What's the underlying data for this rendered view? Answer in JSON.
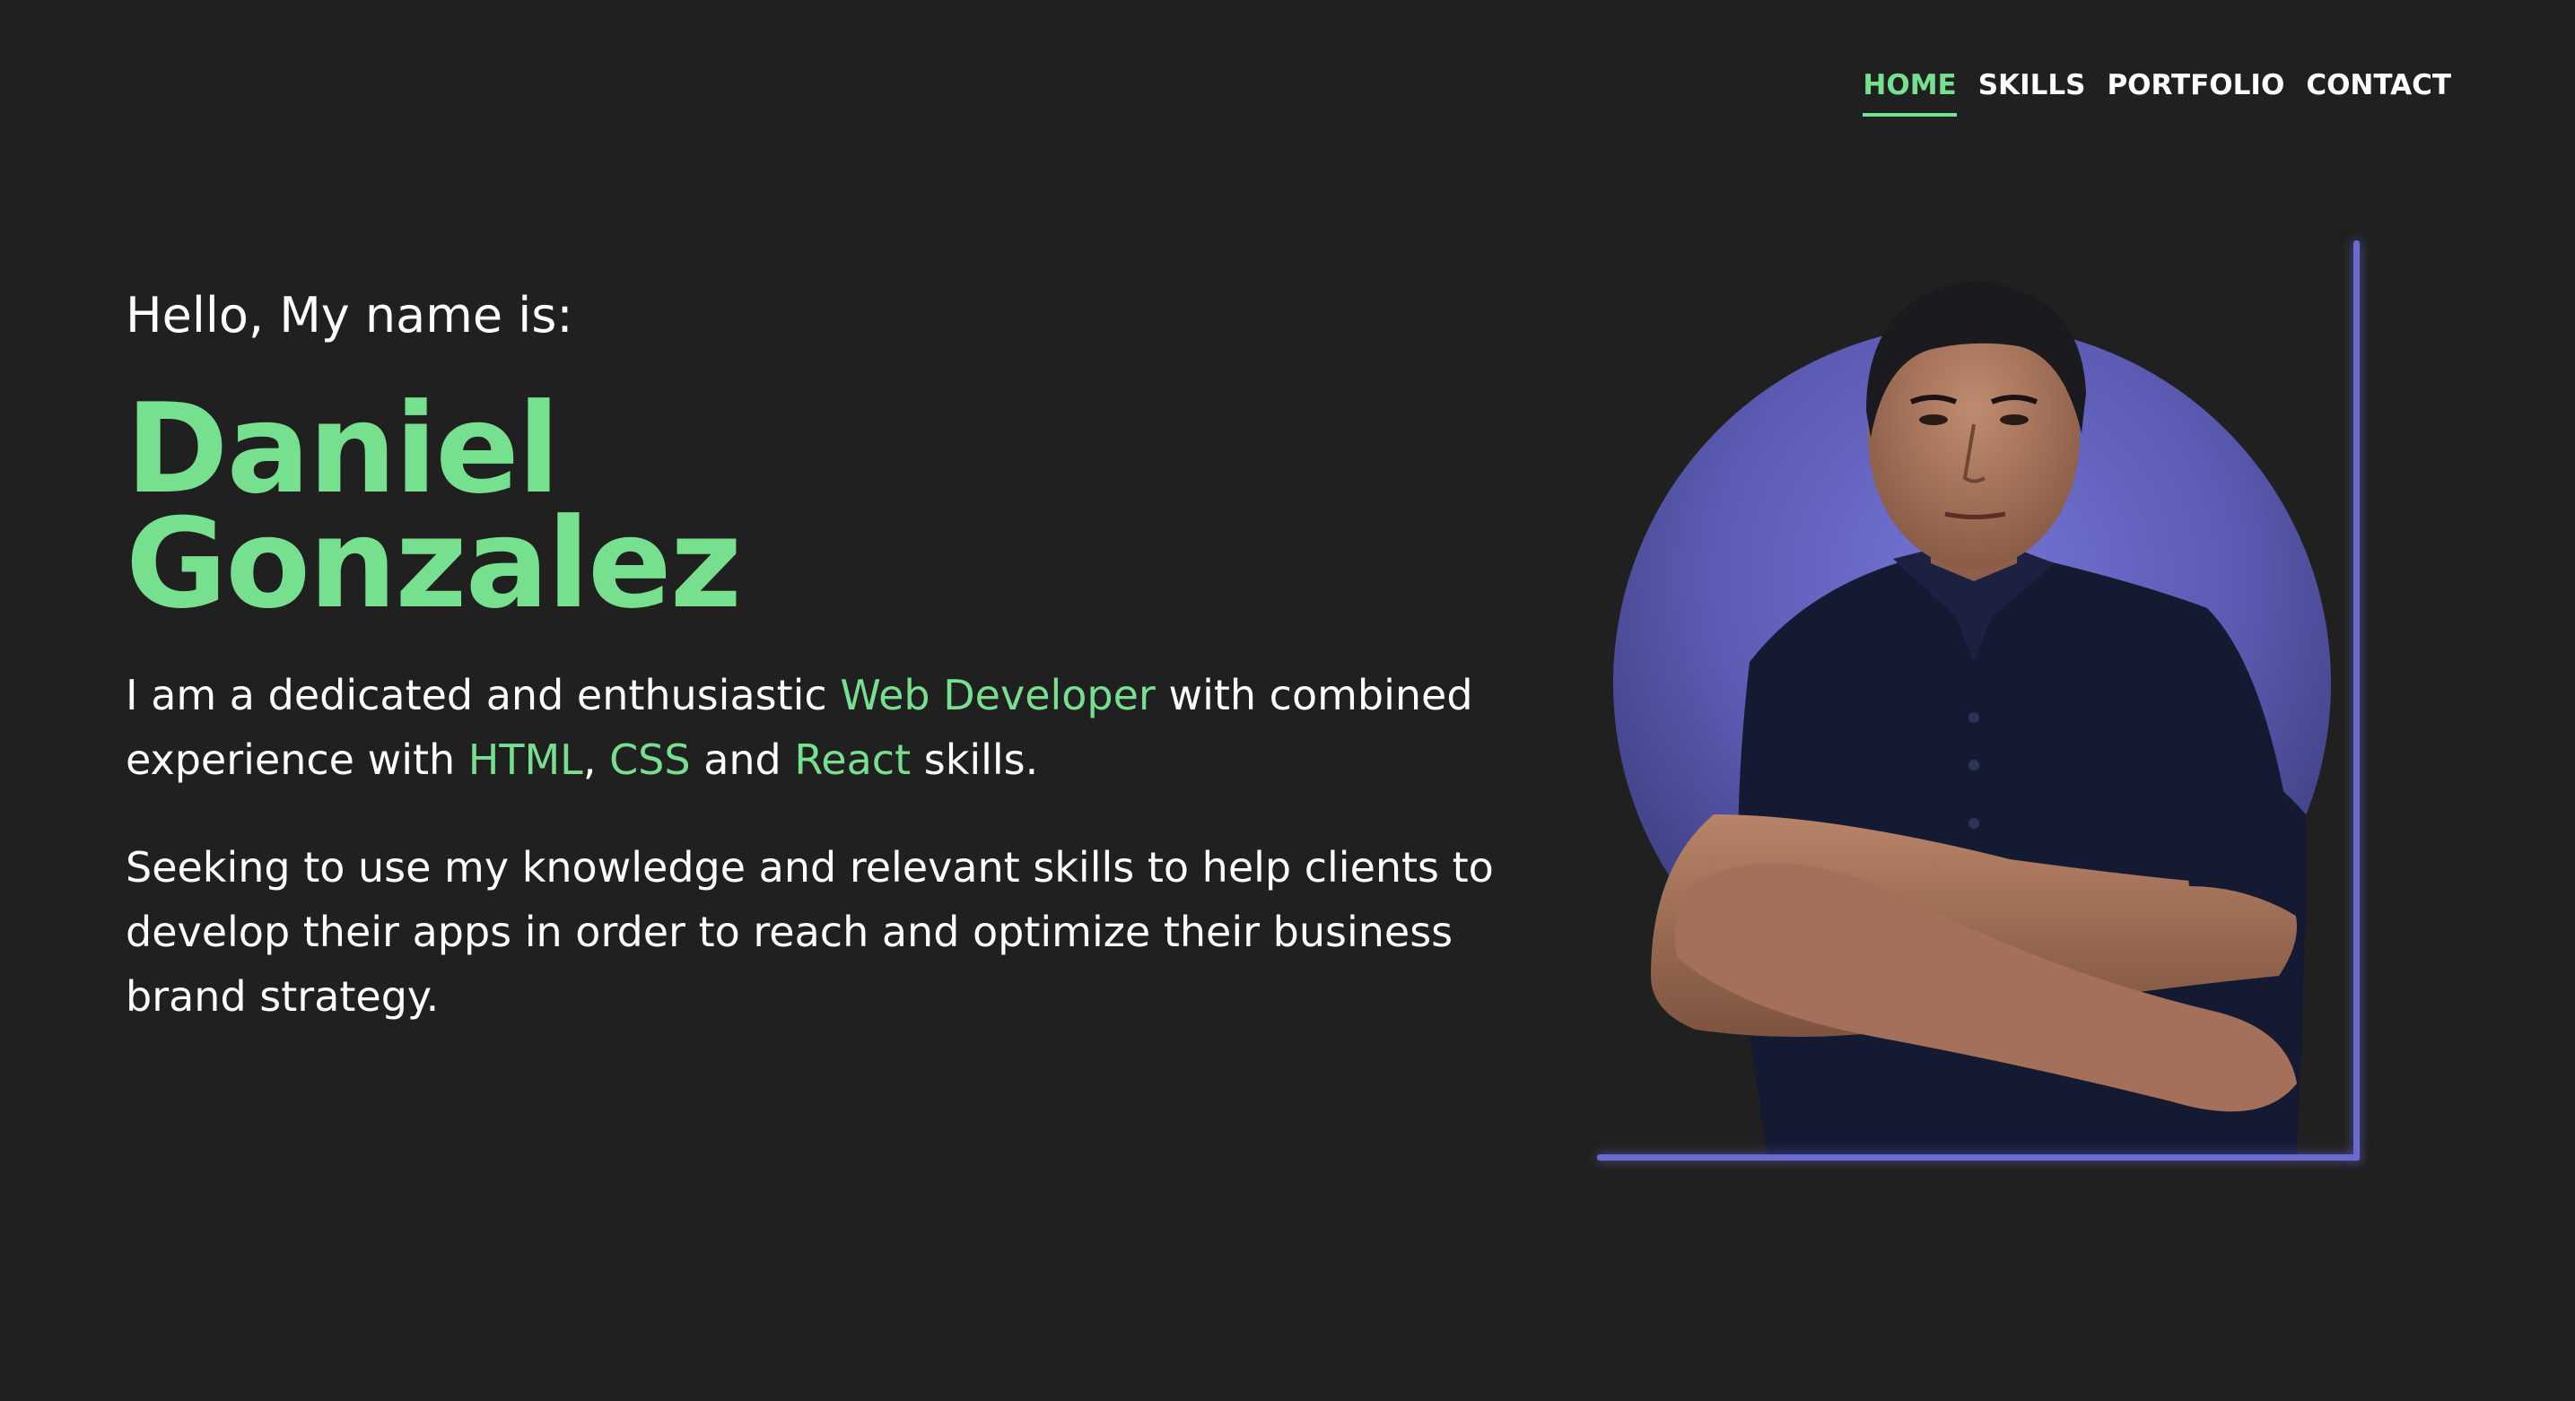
{
  "nav": {
    "items": [
      {
        "label": "HOME",
        "active": true
      },
      {
        "label": "SKILLS",
        "active": false
      },
      {
        "label": "PORTFOLIO",
        "active": false
      },
      {
        "label": "CONTACT",
        "active": false
      }
    ]
  },
  "hero": {
    "greeting": "Hello, My name is:",
    "first_name": "Daniel",
    "last_name": "Gonzalez",
    "intro": {
      "part1": "I am a dedicated and enthusiastic ",
      "role": "Web Developer",
      "part2": " with combined experience with ",
      "skill1": "HTML",
      "sep": ", ",
      "skill2": "CSS",
      "and": " and ",
      "skill3": "React",
      "part3": " skills."
    },
    "objective": "Seeking to use my knowledge and relevant skills to help clients to develop their apps in order to reach and optimize their business brand strategy."
  },
  "colors": {
    "background": "#202020",
    "accent": "#76e08f",
    "frame": "#6a6ad0",
    "circle": "#5a5ab0"
  },
  "icons": {
    "portrait": "profile-photo"
  }
}
